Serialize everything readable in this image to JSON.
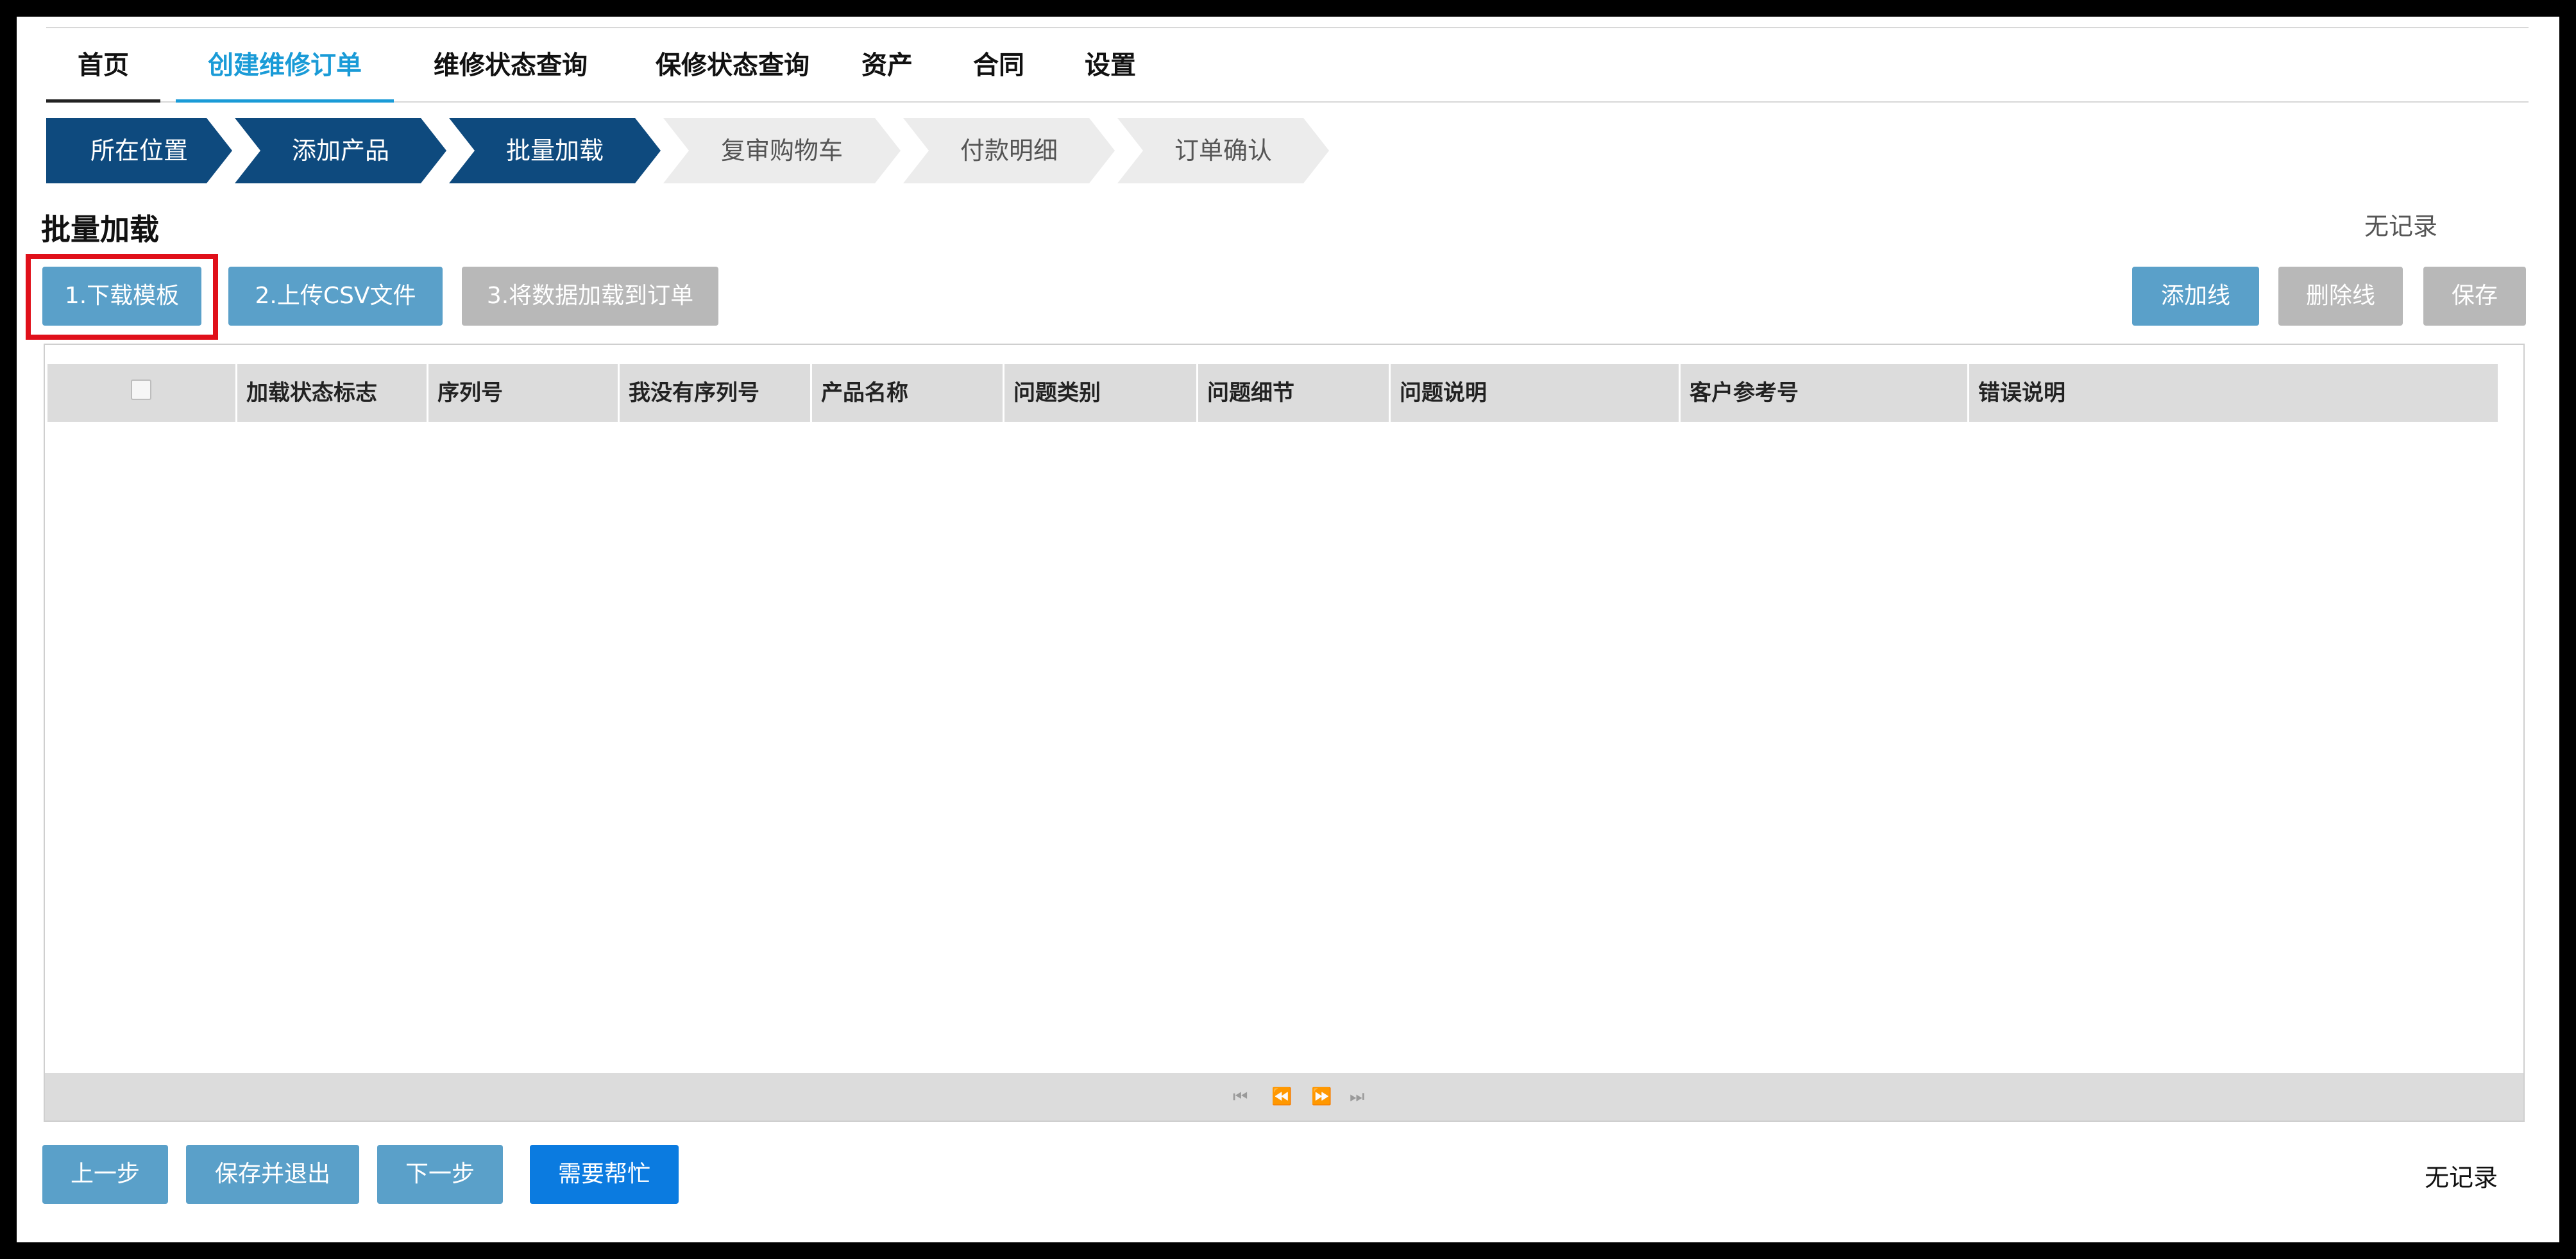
{
  "nav": {
    "items": [
      "首页",
      "创建维修订单",
      "维修状态查询",
      "保修状态查询",
      "资产",
      "合同",
      "设置"
    ],
    "active_index": 1
  },
  "steps": [
    {
      "label": "所在位置",
      "state": "done"
    },
    {
      "label": "添加产品",
      "state": "done"
    },
    {
      "label": "批量加载",
      "state": "done"
    },
    {
      "label": "复审购物车",
      "state": "todo"
    },
    {
      "label": "付款明细",
      "state": "todo"
    },
    {
      "label": "订单确认",
      "state": "todo"
    }
  ],
  "section": {
    "title": "批量加载",
    "status": "无记录"
  },
  "toolbar": {
    "download_template": "1.下载模板",
    "upload_csv": "2.上传CSV文件",
    "load_to_order": "3.将数据加载到订单",
    "add_line": "添加线",
    "delete_line": "删除线",
    "save": "保存"
  },
  "grid": {
    "columns": [
      "加载状态标志",
      "序列号",
      "我没有序列号",
      "产品名称",
      "问题类别",
      "问题细节",
      "问题说明",
      "客户参考号",
      "错误说明"
    ],
    "rows": [],
    "pager": {
      "first": "⏮",
      "prev": "⏪",
      "next": "⏩",
      "last": "⏭"
    }
  },
  "footer": {
    "prev": "上一步",
    "save_exit": "保存并退出",
    "next": "下一步",
    "help": "需要帮忙",
    "status": "无记录"
  },
  "colors": {
    "nav_active": "#1a9bd7",
    "step_done": "#0e4a7e",
    "button_blue": "#5aa0c9",
    "button_disabled": "#b8b8b8",
    "button_primary": "#0b7be0",
    "highlight": "#e0101a"
  }
}
